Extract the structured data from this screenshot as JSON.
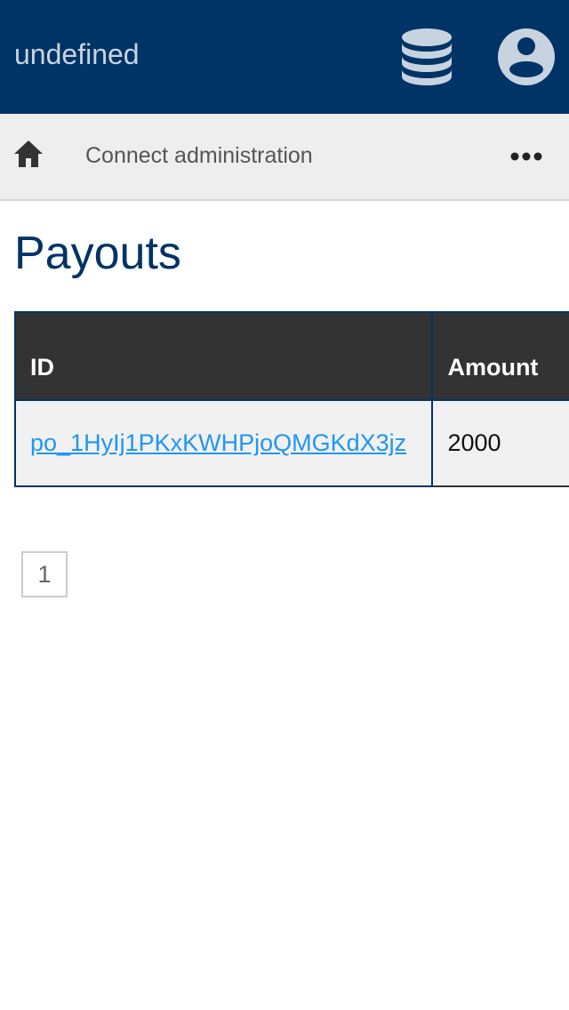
{
  "header": {
    "title": "undefined",
    "icons": [
      "database-icon",
      "user-account-icon"
    ],
    "background_color": "#003366"
  },
  "breadcrumb": {
    "home_icon": "home-icon",
    "label": "Connect administration",
    "more_icon": "more-horizontal-icon"
  },
  "page": {
    "title": "Payouts"
  },
  "table": {
    "columns": [
      "ID",
      "Amount"
    ],
    "rows": [
      {
        "id": "po_1HyIj1PKxKWHPjoQMGKdX3jz",
        "amount": "2000"
      }
    ]
  },
  "pagination": {
    "pages": [
      "1"
    ]
  },
  "colors": {
    "brand": "#003366",
    "link": "#2196f3",
    "table_header": "#333333",
    "row_background": "#f1f1f1"
  }
}
